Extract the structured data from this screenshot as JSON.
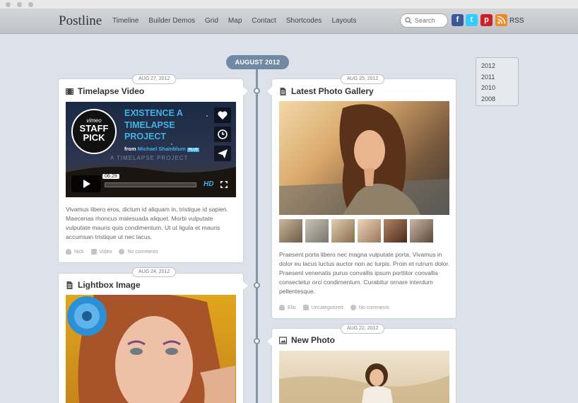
{
  "site": {
    "logo": "Postline"
  },
  "nav": [
    "Timeline",
    "Builder Demos",
    "Grid",
    "Map",
    "Contact",
    "Shortcodes",
    "Layouts"
  ],
  "search": {
    "placeholder": "Search"
  },
  "social": [
    {
      "name": "facebook",
      "glyph": "f",
      "color": "#3b5998"
    },
    {
      "name": "twitter",
      "glyph": "t",
      "color": "#33ccff"
    },
    {
      "name": "pinterest",
      "glyph": "p",
      "color": "#cb2027"
    },
    {
      "name": "rss",
      "glyph": "",
      "color": "#f08a24"
    }
  ],
  "rss_label": "RSS",
  "timeline": {
    "month": "AUGUST 2012"
  },
  "years": [
    "2012",
    "2011",
    "2010",
    "2008"
  ],
  "posts": [
    {
      "date": "AUG 27, 2012",
      "title": "Timelapse Video",
      "icon": "video-icon",
      "video": {
        "badge_top": "vimeo",
        "badge_main": "STAFF PICK",
        "headline": "EXISTENCE A TIMELAPSE PROJECT",
        "byline_prefix": "from",
        "byline_name": "Michael Shainblum",
        "byline_badge": "PLUS",
        "subtitle": "A TIMELAPSE PROJECT",
        "time": "06:29",
        "hd": "HD"
      },
      "excerpt": "Vivamus libero eros, dictum id aliquam in, tristique id sapien. Maecenas rhoncus malesuada aliquet. Morbi vulputate vulputate mauris quis condimentum. Ut ut ligula et mauris accumsan tristique ut nec lacus.",
      "meta": {
        "author": "Nick",
        "category": "Video",
        "comments": "No comments"
      }
    },
    {
      "date": "AUG 25, 2012",
      "title": "Latest Photo Gallery",
      "icon": "document-icon",
      "excerpt": "Praesent porta libero nec magna vulputate porta. Vivamus in dolor eu lacus luctus auctor non ac turpis. Proin et rutrum dolor. Praesent venenatis purus convallis ipsum porttitor convallis consectetur orci condimentum. Curabitur ornare interdum pellentesque.",
      "meta": {
        "author": "Elio",
        "category": "Uncategorized",
        "comments": "No comments"
      }
    },
    {
      "date": "AUG 24, 2012",
      "title": "Lightbox Image",
      "icon": "document-icon"
    },
    {
      "date": "AUG 22, 2012",
      "title": "New Photo",
      "icon": "image-icon"
    }
  ]
}
